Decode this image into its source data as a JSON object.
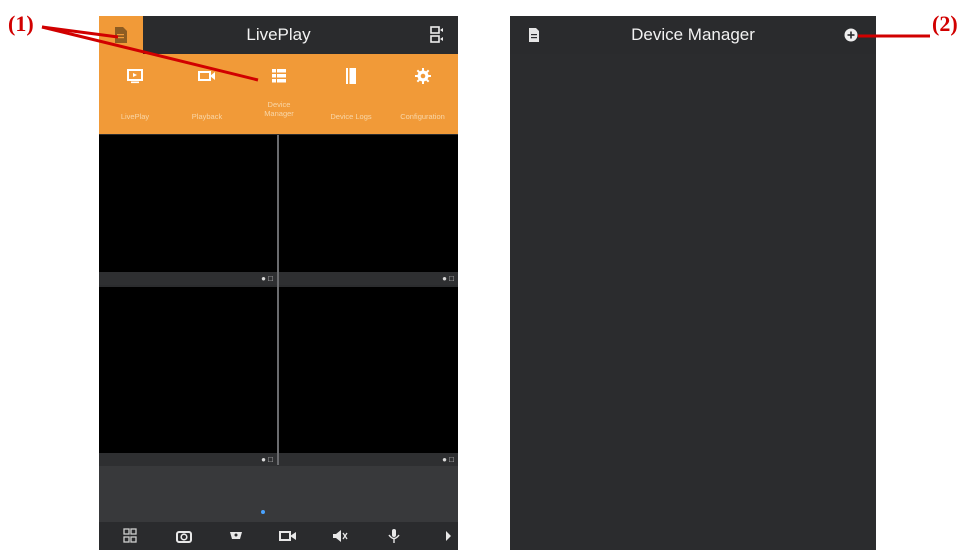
{
  "annotations": {
    "label1": "(1)",
    "label2": "(2)",
    "color": "#d10000"
  },
  "left_screen": {
    "title": "LivePlay",
    "menu_items": [
      {
        "label": "LivePlay",
        "icon": "monitor-play-icon"
      },
      {
        "label": "Playback",
        "icon": "video-camera-icon"
      },
      {
        "label": "Device\nManager",
        "icon": "list-icon"
      },
      {
        "label": "Device Logs",
        "icon": "book-icon"
      },
      {
        "label": "Configuration",
        "icon": "gear-icon"
      }
    ],
    "toolbar": [
      "grid-layout-icon",
      "snapshot-icon",
      "ptz-icon",
      "record-icon",
      "mute-icon",
      "microphone-icon",
      "next-arrow-icon"
    ],
    "accent": "#f19a38"
  },
  "right_screen": {
    "title": "Device Manager"
  }
}
